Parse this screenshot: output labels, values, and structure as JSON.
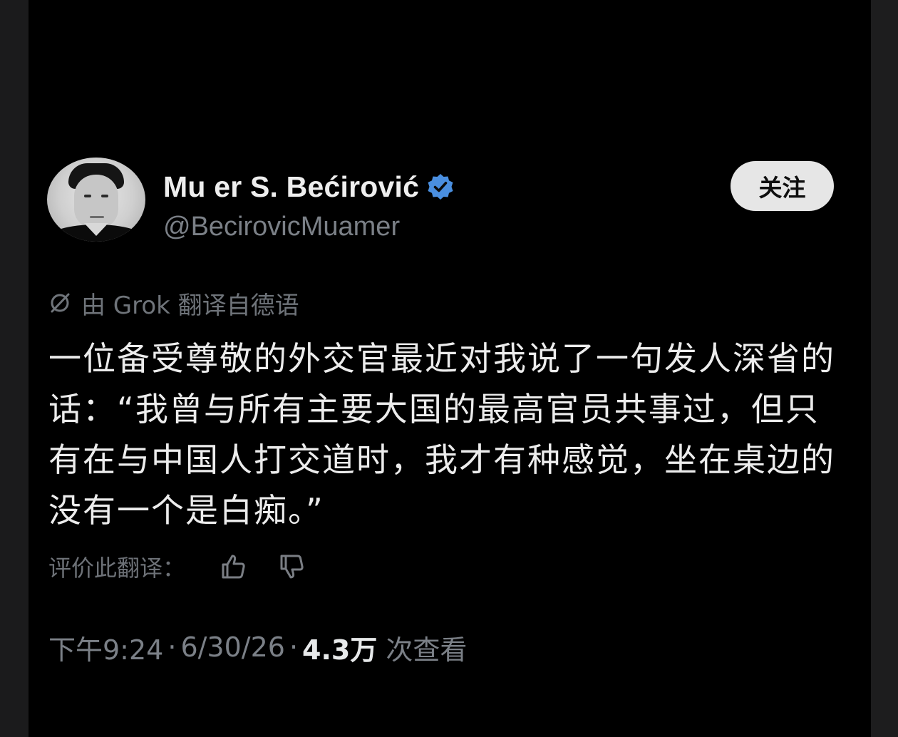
{
  "author": {
    "display_name": "Mu   er S. Bećirović",
    "handle": "@BecirovicMuamer",
    "verified_icon": "verified-badge-icon",
    "avatar": "author-avatar"
  },
  "follow_button": {
    "label": "关注"
  },
  "translation": {
    "icon": "grok-icon",
    "note": "由 Grok 翻译自德语"
  },
  "tweet": {
    "text": "一位备受尊敬的外交官最近对我说了一句发人深省的话：“我曾与所有主要大国的最高官员共事过，但只有在与中国人打交道时，我才有种感觉，坐在桌边的没有一个是白痴。”"
  },
  "rating": {
    "label": "评价此翻译：",
    "thumbs_up_icon": "thumbs-up-icon",
    "thumbs_down_icon": "thumbs-down-icon"
  },
  "meta": {
    "time": "下午9:24",
    "date": "6/30/26",
    "separator": "·",
    "views_count": "4.3万",
    "views_label": "次查看"
  },
  "colors": {
    "background": "#000000",
    "text_primary": "#ececec",
    "text_secondary": "#7b8087",
    "verified_blue": "#4a8fe0",
    "follow_button_bg": "#e6e6e6"
  }
}
